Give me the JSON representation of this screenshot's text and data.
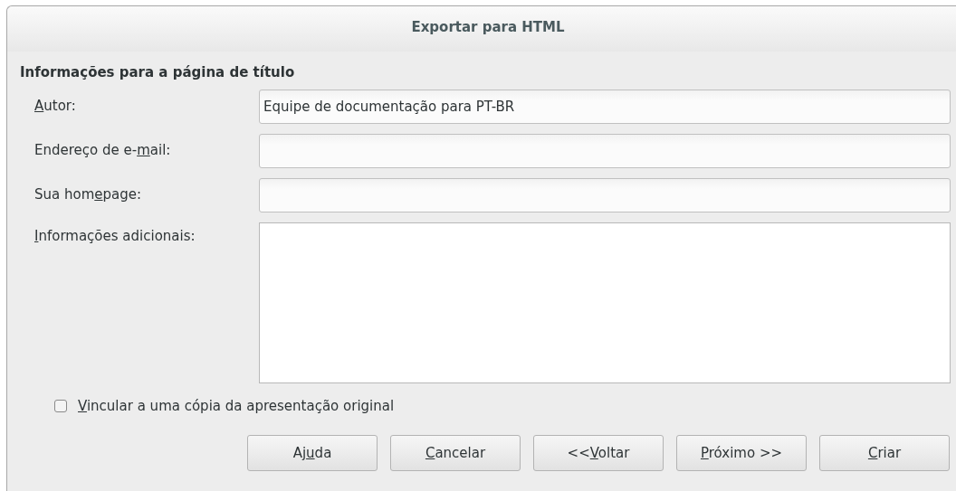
{
  "window": {
    "title": "Exportar para HTML"
  },
  "section": {
    "heading": "Informações para a página de título"
  },
  "fields": [
    {
      "kind": "line",
      "label": {
        "key": "A",
        "post": "utor:"
      },
      "value": "Equipe de documentação para PT-BR"
    },
    {
      "kind": "line",
      "label": {
        "pre": "Endereço de e-",
        "key": "m",
        "post": "ail:"
      }
    },
    {
      "kind": "line",
      "label": {
        "pre": "Sua hom",
        "key": "e",
        "post": "page:"
      }
    },
    {
      "kind": "area",
      "label": {
        "key": "I",
        "post": "nformações adicionais:"
      }
    }
  ],
  "checkbox": {
    "label": {
      "key": "V",
      "post": "incular a uma cópia da apresentação original"
    },
    "checked": false
  },
  "buttons": [
    {
      "label": {
        "pre": "Aj",
        "key": "u",
        "post": "da"
      }
    },
    {
      "label": {
        "key": "C",
        "post": "ancelar"
      }
    },
    {
      "label": {
        "pre": "<<",
        "key": "V",
        "post": "oltar"
      }
    },
    {
      "label": {
        "key": "P",
        "post": "róximo >>"
      }
    },
    {
      "label": {
        "key": "C",
        "post": "riar"
      }
    }
  ]
}
